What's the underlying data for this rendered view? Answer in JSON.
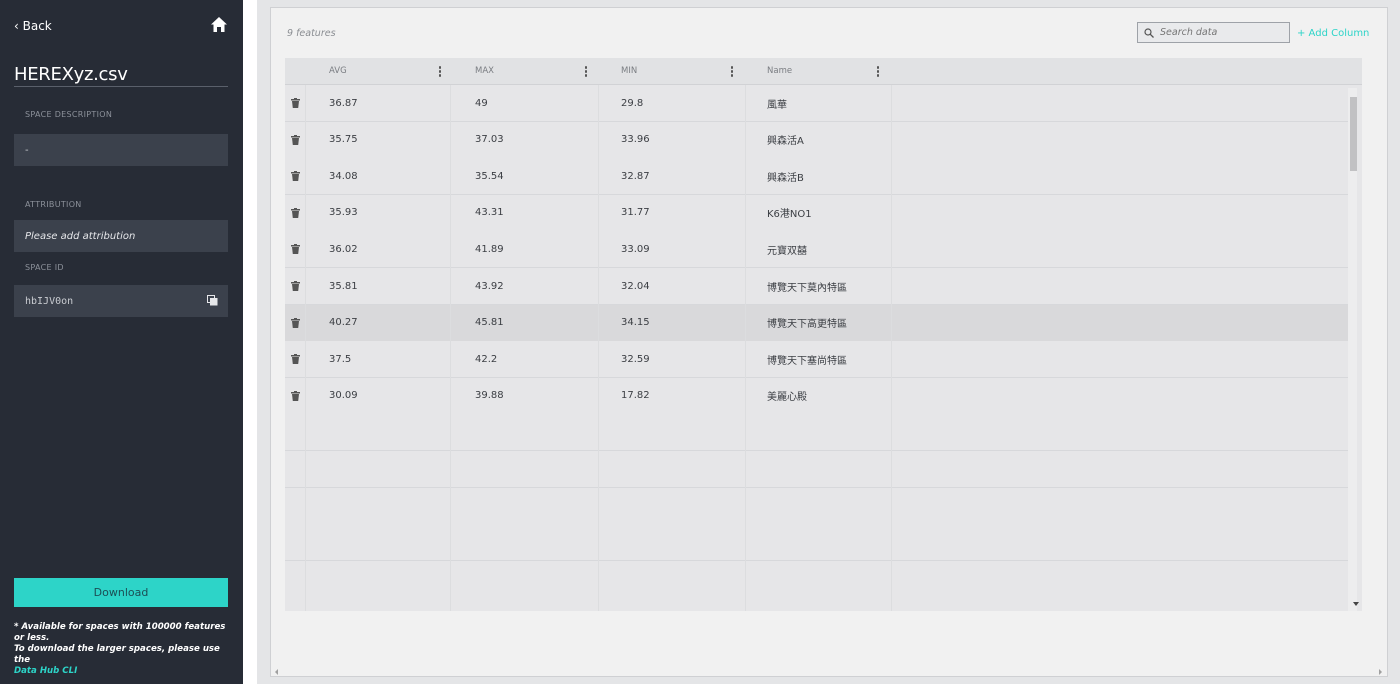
{
  "sidebar": {
    "back_label": "‹ Back",
    "file_title": "HEREXyz.csv",
    "description_label": "SPACE DESCRIPTION",
    "description_value": "-",
    "attribution_label": "ATTRIBUTION",
    "attribution_placeholder": "Please add attribution",
    "space_id_label": "SPACE ID",
    "space_id_value": "hbIJV0on",
    "download_label": "Download",
    "note_line1": "* Available for spaces with 100000 features or less.",
    "note_line2": "To download the larger spaces, please use the",
    "note_link": "Data Hub CLI"
  },
  "toolbar": {
    "feature_count": "9 features",
    "search_placeholder": "Search data",
    "add_column_label": "+ Add Column"
  },
  "table": {
    "columns": [
      "AVG",
      "MAX",
      "MIN",
      "Name"
    ],
    "rows": [
      {
        "avg": "36.87",
        "max": "49",
        "min": "29.8",
        "name": "風華"
      },
      {
        "avg": "35.75",
        "max": "37.03",
        "min": "33.96",
        "name": "興森活A"
      },
      {
        "avg": "34.08",
        "max": "35.54",
        "min": "32.87",
        "name": "興森活B"
      },
      {
        "avg": "35.93",
        "max": "43.31",
        "min": "31.77",
        "name": "K6港NO1"
      },
      {
        "avg": "36.02",
        "max": "41.89",
        "min": "33.09",
        "name": "元寶双囍"
      },
      {
        "avg": "35.81",
        "max": "43.92",
        "min": "32.04",
        "name": "博覽天下莫內特區"
      },
      {
        "avg": "40.27",
        "max": "45.81",
        "min": "34.15",
        "name": "博覽天下高更特區"
      },
      {
        "avg": "37.5",
        "max": "42.2",
        "min": "32.59",
        "name": "博覽天下塞尚特區"
      },
      {
        "avg": "30.09",
        "max": "39.88",
        "min": "17.82",
        "name": "美麗心殿"
      }
    ]
  },
  "colors": {
    "sidebar_bg": "#272c36",
    "accent": "#2dd4c8"
  },
  "icons": [
    "chevron-left-icon",
    "home-icon",
    "copy-icon",
    "search-icon",
    "trash-icon",
    "kebab-menu-icon"
  ]
}
